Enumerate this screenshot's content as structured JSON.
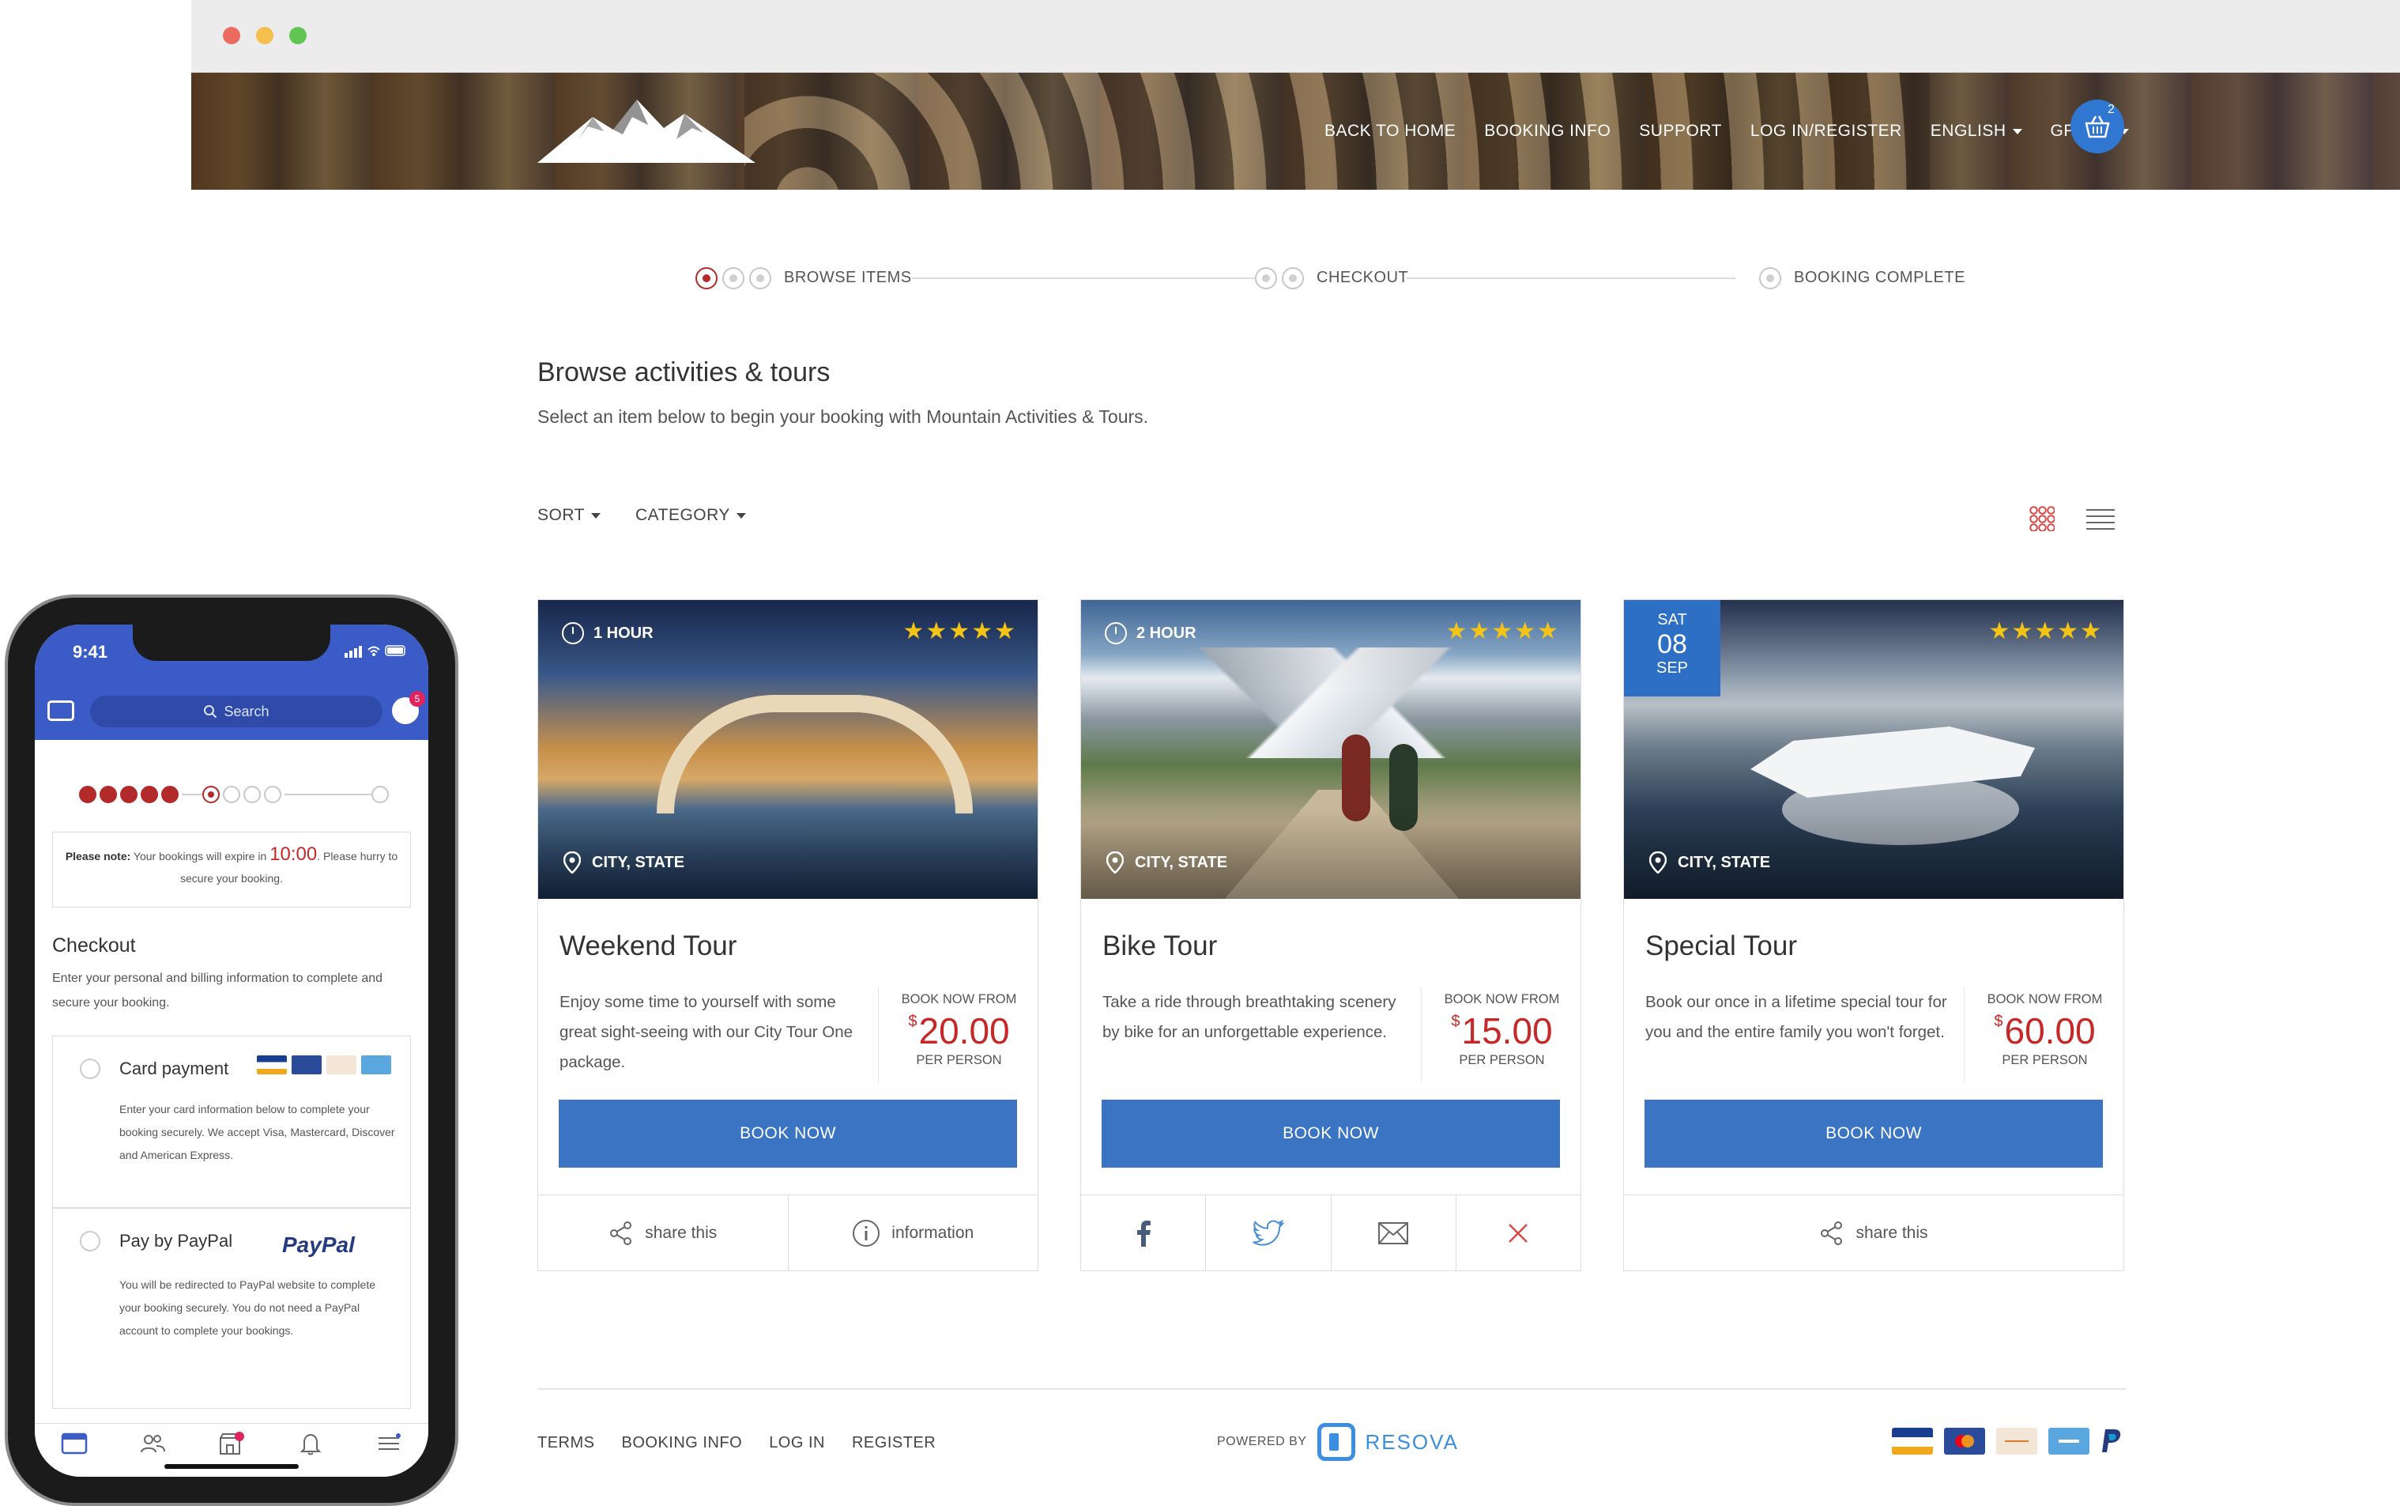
{
  "header": {
    "nav": [
      {
        "label": "BACK TO HOME",
        "dropdown": false
      },
      {
        "label": "BOOKING INFO",
        "dropdown": false
      },
      {
        "label": "SUPPORT",
        "dropdown": false
      },
      {
        "label": "LOG IN/REGISTER",
        "dropdown": false
      },
      {
        "label": "ENGLISH",
        "dropdown": true
      },
      {
        "label": "GPB (£)",
        "dropdown": true
      }
    ],
    "cart_count": "2",
    "cart_icon": "basket-icon",
    "logo_icon": "mountain-logo"
  },
  "progress": {
    "steps": [
      {
        "label": "BROWSE ITEMS",
        "state": "active"
      },
      {
        "label": "CHECKOUT",
        "state": "pending"
      },
      {
        "label": "BOOKING COMPLETE",
        "state": "pending"
      }
    ]
  },
  "main": {
    "title": "Browse activities & tours",
    "subtitle": "Select an item below to begin your booking with Mountain Activities & Tours.",
    "filters": {
      "sort": "SORT",
      "category": "CATEGORY"
    },
    "view_icons": [
      "grid-view-icon",
      "list-view-icon"
    ]
  },
  "cards": [
    {
      "badge": "1 HOUR",
      "stars": "★★★★★",
      "location": "CITY, STATE",
      "title": "Weekend Tour",
      "description": "Enjoy some time to yourself with some great sight-seeing with our City Tour One package.",
      "price_from": "BOOK NOW FROM",
      "currency": "$",
      "price": "20.00",
      "per": "PER PERSON",
      "button": "BOOK NOW",
      "footer": [
        "share this",
        "information"
      ]
    },
    {
      "badge": "2 HOUR",
      "stars": "★★★★★",
      "location": "CITY, STATE",
      "title": "Bike Tour",
      "description": "Take a ride through breathtaking scenery by bike for an unforgettable experience.",
      "price_from": "BOOK NOW FROM",
      "currency": "$",
      "price": "15.00",
      "per": "PER PERSON",
      "button": "BOOK NOW",
      "footer_icons": [
        "facebook-icon",
        "twitter-icon",
        "email-icon",
        "close-icon"
      ]
    },
    {
      "date": {
        "day": "SAT",
        "num": "08",
        "month": "SEP"
      },
      "stars": "★★★★★",
      "location": "CITY, STATE",
      "title": "Special Tour",
      "description": "Book our once in a lifetime special tour for you and the entire family you won't forget.",
      "price_from": "BOOK NOW FROM",
      "currency": "$",
      "price": "60.00",
      "per": "PER PERSON",
      "button": "BOOK NOW",
      "footer": [
        "share this"
      ]
    }
  ],
  "footer": {
    "links": [
      "TERMS",
      "BOOKING INFO",
      "LOG IN",
      "REGISTER"
    ],
    "powered_by": "POWERED BY",
    "brand": "RESOVA",
    "payment_icons": [
      "visa-icon",
      "mastercard-icon",
      "discover-icon",
      "amex-icon",
      "paypal-icon"
    ]
  },
  "colors": {
    "accent": "#3a74c2",
    "price": "#c62828",
    "stars": "#f3c316",
    "progress": "#b22a2a"
  },
  "phone": {
    "time": "9:41",
    "search_placeholder": "Search",
    "messenger_badge": "5",
    "progress_done": [
      "1",
      "2",
      "3",
      "4",
      "5"
    ],
    "note_prefix": "Please note:",
    "note_text_1": " Your bookings will expire in ",
    "timer": "10:00",
    "note_text_2": ". Please hurry to secure your booking.",
    "checkout_title": "Checkout",
    "checkout_desc": "Enter your personal and billing information to complete and secure your booking.",
    "card_payment": {
      "title": "Card payment",
      "desc": "Enter your card information below to complete your booking securely. We accept Visa, Mastercard, Discover and American Express."
    },
    "paypal_payment": {
      "title": "Pay by PayPal",
      "logo": "PayPal",
      "desc": "You will be redirected to PayPal website to complete your booking securely. You do not need a PayPal account to complete your bookings."
    },
    "tab_badge": "1"
  }
}
